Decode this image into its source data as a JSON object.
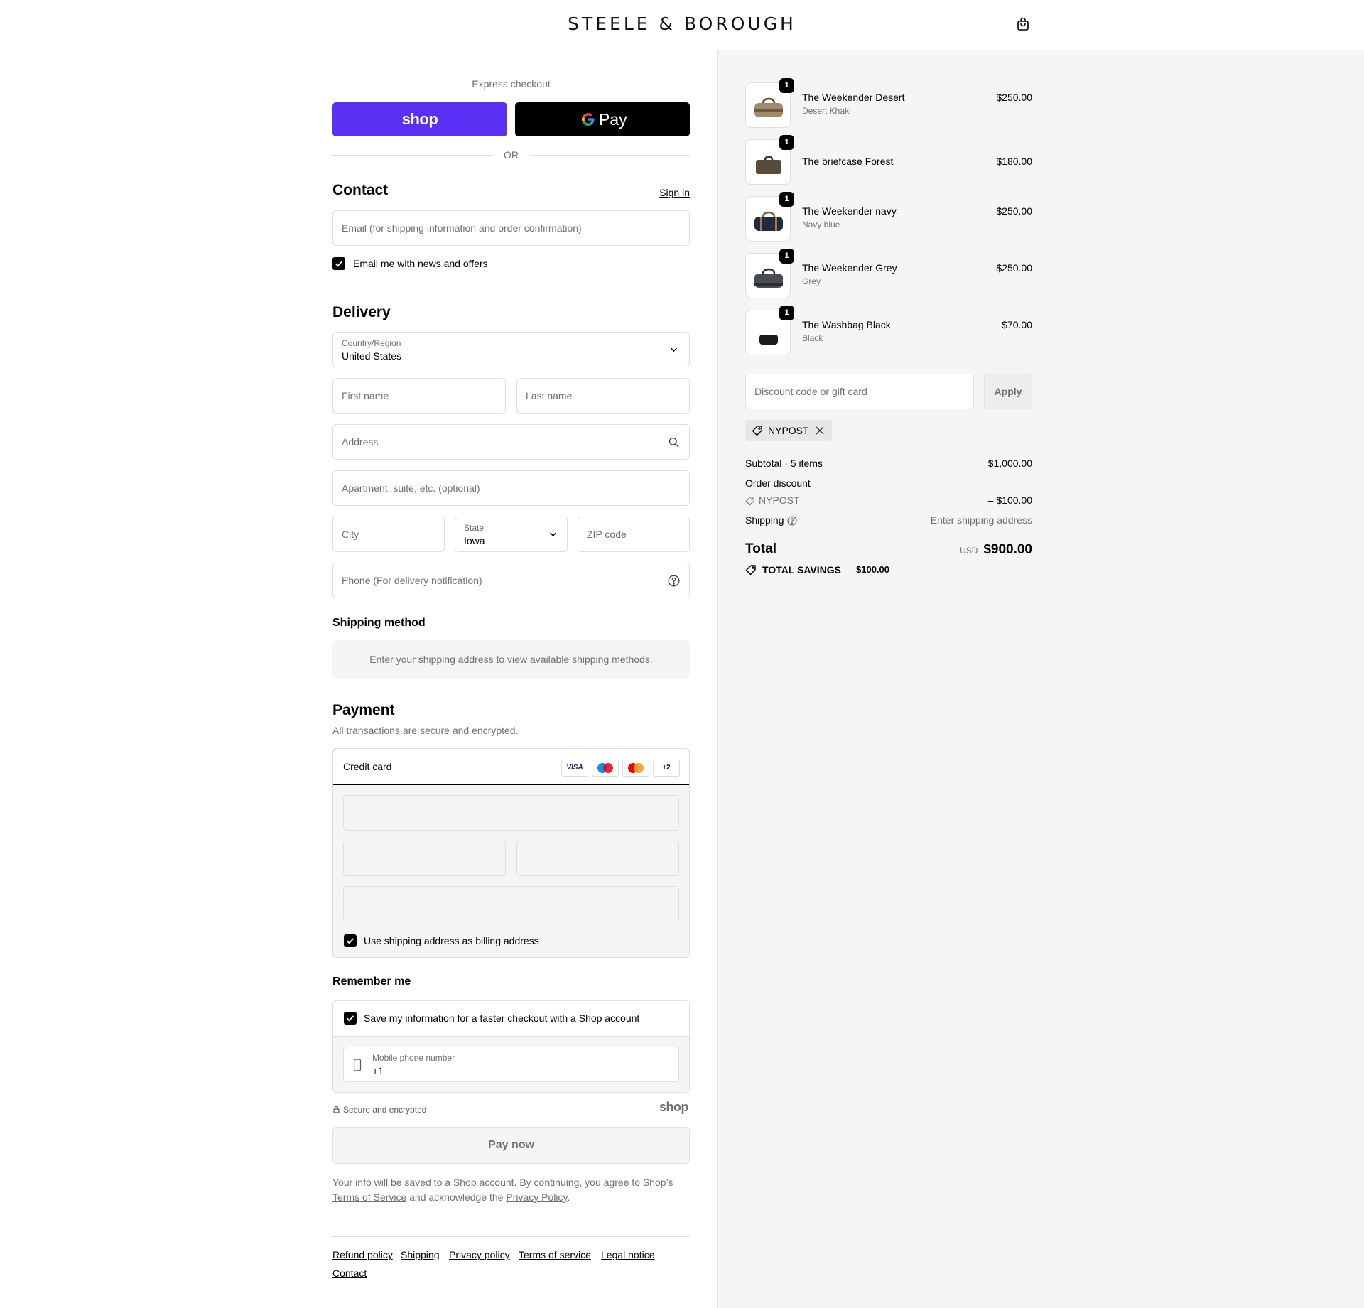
{
  "header": {
    "brand": "STEELE & BOROUGH",
    "cart_icon": "shopping-bag-icon"
  },
  "express": {
    "label": "Express checkout",
    "shop_pay_label": "shop",
    "gpay_label": "Pay",
    "or_label": "OR",
    "colors": {
      "shop": "#5a31f4",
      "gpay": "#000000"
    }
  },
  "contact": {
    "title": "Contact",
    "sign_in": "Sign in",
    "email_placeholder": "Email (for shipping information and order confirmation)",
    "newsletter_label": "Email me with news and offers",
    "newsletter_checked": true
  },
  "delivery": {
    "title": "Delivery",
    "country_label": "Country/Region",
    "country_value": "United States",
    "first_name_placeholder": "First name",
    "last_name_placeholder": "Last name",
    "address_placeholder": "Address",
    "apartment_placeholder": "Apartment, suite, etc. (optional)",
    "city_placeholder": "City",
    "state_label": "State",
    "state_value": "Iowa",
    "zip_placeholder": "ZIP code",
    "phone_placeholder": "Phone (For delivery notification)"
  },
  "shipping_method": {
    "title": "Shipping method",
    "message": "Enter your shipping address to view available shipping methods."
  },
  "payment": {
    "title": "Payment",
    "subtitle": "All transactions are secure and encrypted.",
    "method_label": "Credit card",
    "card_brands": [
      "VISA",
      "maestro",
      "mastercard"
    ],
    "more_cards": "+2",
    "billing_label": "Use shipping address as billing address",
    "billing_checked": true
  },
  "remember": {
    "title": "Remember me",
    "save_label": "Save my information for a faster checkout with a Shop account",
    "save_checked": true,
    "mobile_label": "Mobile phone number",
    "mobile_value": "+1"
  },
  "secure_label": "Secure and encrypted",
  "shop_logo_text": "shop",
  "pay_button": "Pay now",
  "legal": {
    "text_1": "Your info will be saved to a Shop account. By continuing, you agree to Shop’s",
    "terms_link": "Terms of Service",
    "text_2": "and acknowledge the",
    "privacy_link": "Privacy Policy",
    "text_3": "."
  },
  "footer_links": [
    "Refund policy",
    "Shipping",
    "Privacy policy",
    "Terms of service",
    "Legal notice",
    "Contact"
  ],
  "order": {
    "products": [
      {
        "name": "The Weekender Desert",
        "variant": "Desert Khaki",
        "price": "$250.00",
        "qty": "1",
        "color": "#a08a6a"
      },
      {
        "name": "The briefcase Forest",
        "variant": "",
        "price": "$180.00",
        "qty": "1",
        "color": "#5a4a3a"
      },
      {
        "name": "The Weekender navy",
        "variant": "Navy blue",
        "price": "$250.00",
        "qty": "1",
        "color": "#1f2a44"
      },
      {
        "name": "The Weekender Grey",
        "variant": "Grey",
        "price": "$250.00",
        "qty": "1",
        "color": "#4a4d52"
      },
      {
        "name": "The Washbag Black",
        "variant": "Black",
        "price": "$70.00",
        "qty": "1",
        "color": "#1a1a1a"
      }
    ],
    "discount_placeholder": "Discount code or gift card",
    "apply_label": "Apply",
    "applied_code": "NYPOST",
    "subtotal_label": "Subtotal · 5 items",
    "subtotal_value": "$1,000.00",
    "order_discount_label": "Order discount",
    "discount_code": "NYPOST",
    "discount_value": "– $100.00",
    "shipping_label": "Shipping",
    "shipping_value": "Enter shipping address",
    "total_label": "Total",
    "currency": "USD",
    "total_value": "$900.00",
    "savings_label": "TOTAL SAVINGS",
    "savings_value": "$100.00"
  }
}
